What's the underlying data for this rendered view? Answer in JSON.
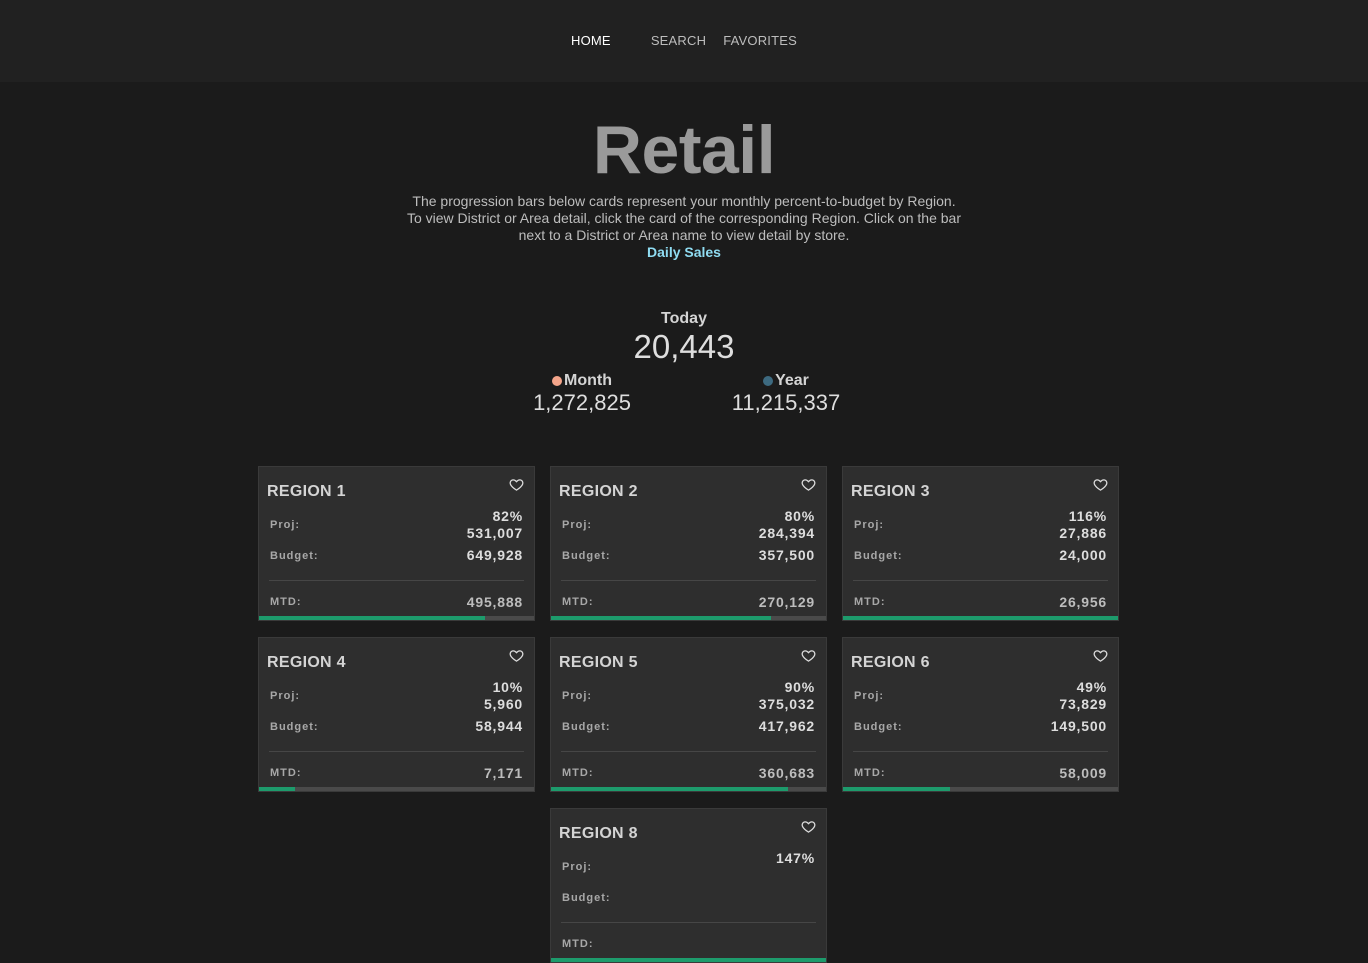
{
  "nav": {
    "home": "HOME",
    "search": "SEARCH",
    "favorites": "FAVORITES"
  },
  "hero": {
    "title": "Retail",
    "description": "The progression bars below cards represent your monthly percent-to-budget by Region. To view District or Area detail, click the card of the corresponding Region. Click on the bar next to a District or Area name to view detail by store.",
    "link": "Daily Sales"
  },
  "totals": {
    "today_label": "Today",
    "today_value": "20,443",
    "month_label": "Month",
    "month_value": "1,272,825",
    "month_color": "#f4a58a",
    "year_label": "Year",
    "year_value": "11,215,337",
    "year_color": "#3d6a80"
  },
  "labels": {
    "proj": "Proj:",
    "budget": "Budget:",
    "mtd": "MTD:"
  },
  "colors": {
    "progress": "#1d9b6c",
    "link": "#8fdcf2"
  },
  "cards": [
    {
      "name": "REGION 1",
      "pct": "82%",
      "proj": "531,007",
      "budget": "649,928",
      "mtd": "495,888",
      "progress": 0.82
    },
    {
      "name": "REGION 2",
      "pct": "80%",
      "proj": "284,394",
      "budget": "357,500",
      "mtd": "270,129",
      "progress": 0.8
    },
    {
      "name": "REGION 3",
      "pct": "116%",
      "proj": "27,886",
      "budget": "24,000",
      "mtd": "26,956",
      "progress": 1.0
    },
    {
      "name": "REGION 4",
      "pct": "10%",
      "proj": "5,960",
      "budget": "58,944",
      "mtd": "7,171",
      "progress": 0.13
    },
    {
      "name": "REGION 5",
      "pct": "90%",
      "proj": "375,032",
      "budget": "417,962",
      "mtd": "360,683",
      "progress": 0.86
    },
    {
      "name": "REGION 6",
      "pct": "49%",
      "proj": "73,829",
      "budget": "149,500",
      "mtd": "58,009",
      "progress": 0.39
    },
    {
      "name": "REGION 8",
      "pct": "147%",
      "proj": "",
      "budget": "",
      "mtd": "",
      "progress": 1.0
    }
  ]
}
